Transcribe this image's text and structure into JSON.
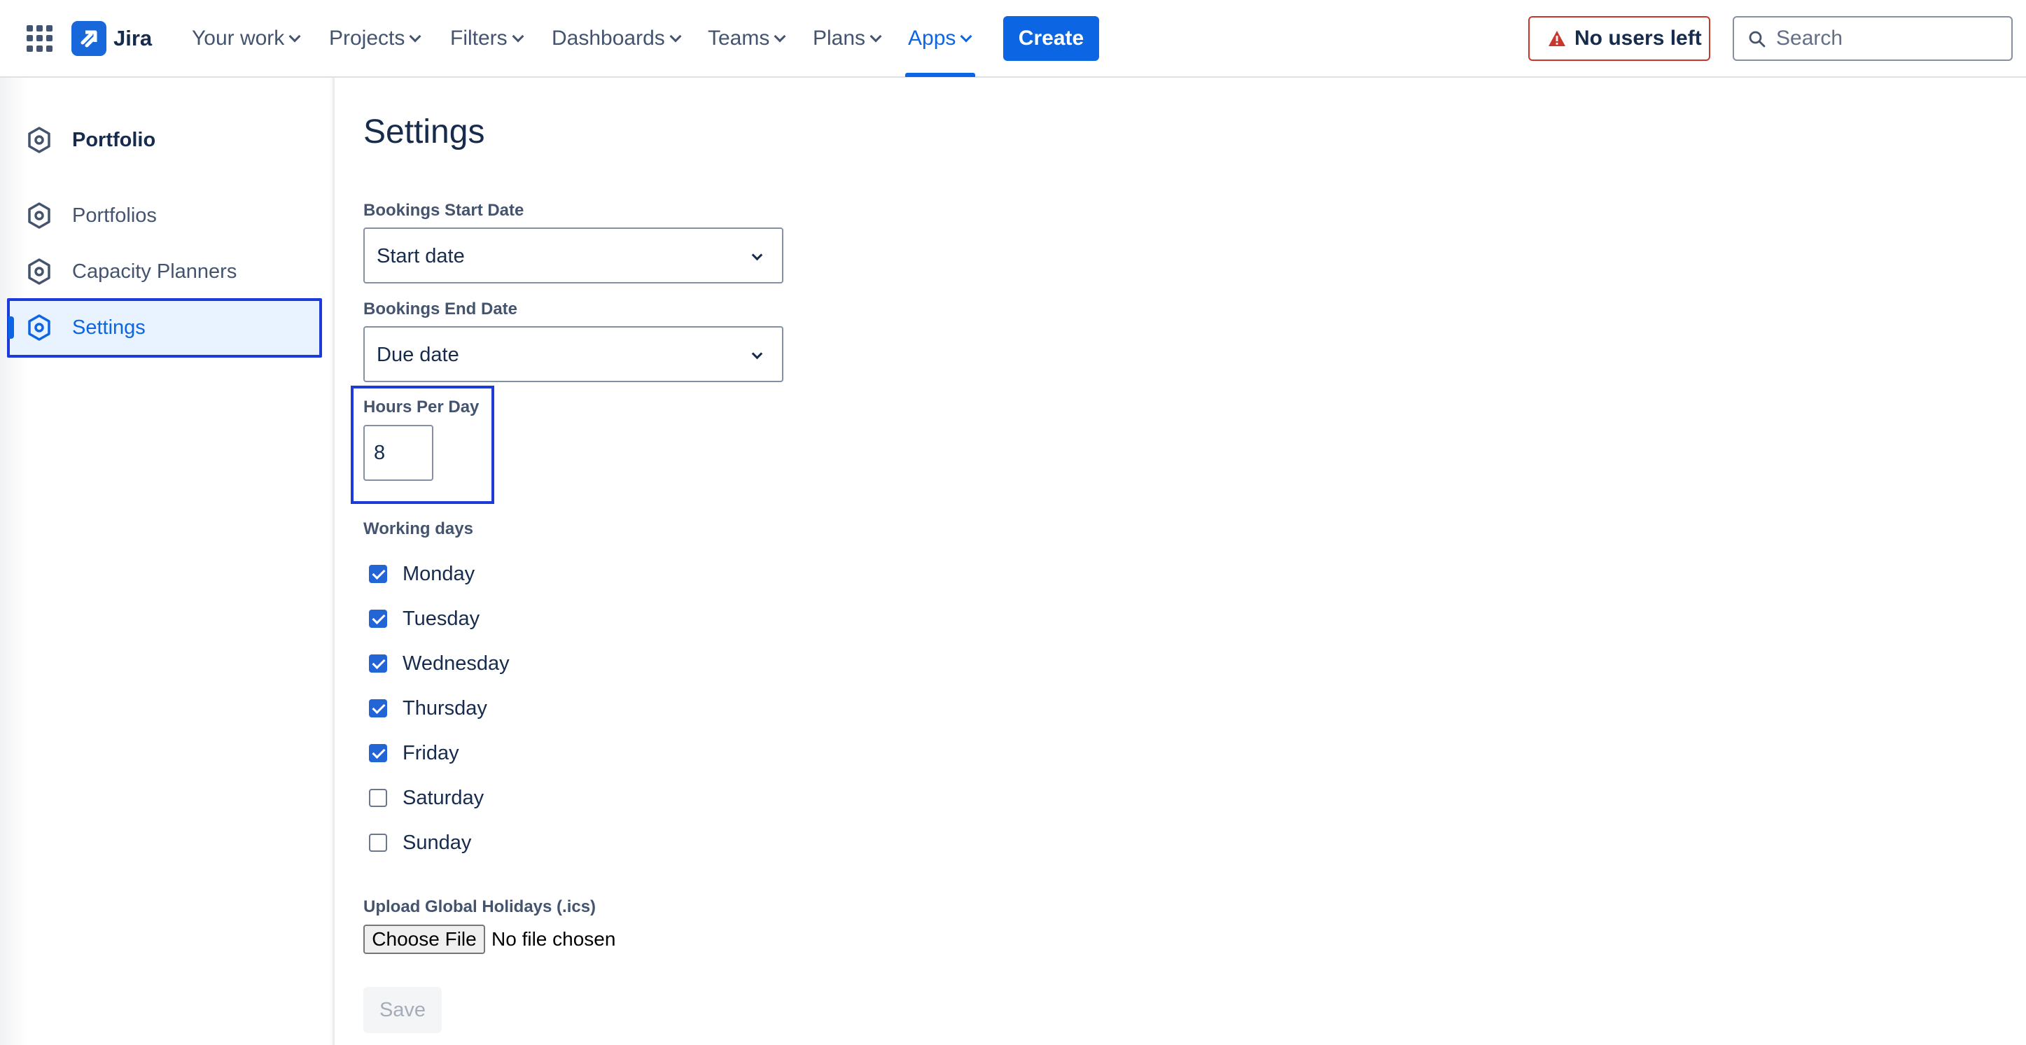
{
  "topnav": {
    "app_name": "Jira",
    "items": [
      {
        "label": "Your work"
      },
      {
        "label": "Projects"
      },
      {
        "label": "Filters"
      },
      {
        "label": "Dashboards"
      },
      {
        "label": "Teams"
      },
      {
        "label": "Plans"
      },
      {
        "label": "Apps",
        "active": true
      }
    ],
    "create_label": "Create",
    "warning_label": "No users left",
    "search_placeholder": "Search",
    "accent_color": "#0c66e4",
    "warning_color": "#c9372c"
  },
  "sidebar": {
    "header": {
      "label": "Portfolio",
      "icon": "hexagon-icon"
    },
    "items": [
      {
        "label": "Portfolios",
        "icon": "hexagon-icon"
      },
      {
        "label": "Capacity Planners",
        "icon": "hexagon-icon"
      },
      {
        "label": "Settings",
        "icon": "hexagon-icon",
        "selected": true
      }
    ]
  },
  "settings": {
    "title": "Settings",
    "bookings_start": {
      "label": "Bookings Start Date",
      "value": "Start date"
    },
    "bookings_end": {
      "label": "Bookings End Date",
      "value": "Due date"
    },
    "hours_per_day": {
      "label": "Hours Per Day",
      "value": "8"
    },
    "working_days": {
      "label": "Working days",
      "days": [
        {
          "label": "Monday",
          "checked": true
        },
        {
          "label": "Tuesday",
          "checked": true
        },
        {
          "label": "Wednesday",
          "checked": true
        },
        {
          "label": "Thursday",
          "checked": true
        },
        {
          "label": "Friday",
          "checked": true
        },
        {
          "label": "Saturday",
          "checked": false
        },
        {
          "label": "Sunday",
          "checked": false
        }
      ]
    },
    "upload": {
      "label": "Upload Global Holidays (.ics)",
      "button_label": "Choose File",
      "status": "No file chosen"
    },
    "save_label": "Save"
  }
}
